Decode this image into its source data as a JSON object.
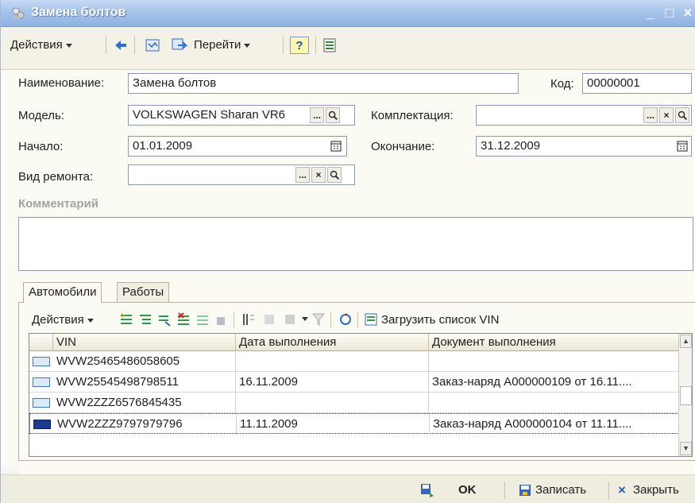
{
  "window": {
    "title": "Замена болтов"
  },
  "toolbar": {
    "actions_label": "Действия",
    "goto_label": "Перейти",
    "help_label": "?"
  },
  "form": {
    "name_label": "Наименование:",
    "name_value": "Замена болтов",
    "code_label": "Код:",
    "code_value": "00000001",
    "model_label": "Модель:",
    "model_value": "VOLKSWAGEN Sharan VR6",
    "complect_label": "Комплектация:",
    "complect_value": "",
    "start_label": "Начало:",
    "start_value": "01.01.2009",
    "end_label": "Окончание:",
    "end_value": "31.12.2009",
    "repair_type_label": "Вид ремонта:",
    "repair_type_value": "",
    "comment_label": "Комментарий",
    "comment_value": ""
  },
  "tabs": [
    {
      "label": "Автомобили"
    },
    {
      "label": "Работы"
    }
  ],
  "tab_toolbar": {
    "actions_label": "Действия",
    "load_vin_label": "Загрузить список VIN"
  },
  "table": {
    "columns": [
      "VIN",
      "Дата выполнения",
      "Документ выполнения"
    ],
    "rows": [
      {
        "vin": "WVW25465486058605",
        "date": "",
        "doc": ""
      },
      {
        "vin": "WVW25545498798511",
        "date": "16.11.2009",
        "doc": "Заказ-наряд А000000109 от 16.11...."
      },
      {
        "vin": "WVW2ZZZ6576845435",
        "date": "",
        "doc": ""
      },
      {
        "vin": "WVW2ZZZ9797979796",
        "date": "11.11.2009",
        "doc": "Заказ-наряд А000000104 от 11.11...."
      }
    ]
  },
  "footer": {
    "ok_label": "OK",
    "save_label": "Записать",
    "close_label": "Закрыть"
  },
  "icons": {
    "select_button": "...",
    "clear_button": "×",
    "search_button": "magnifier-icon",
    "calendar_button": "calendar-icon",
    "scroll_up": "▲",
    "scroll_down": "▼",
    "minimize": "_",
    "maximize": "□",
    "close": "×"
  }
}
